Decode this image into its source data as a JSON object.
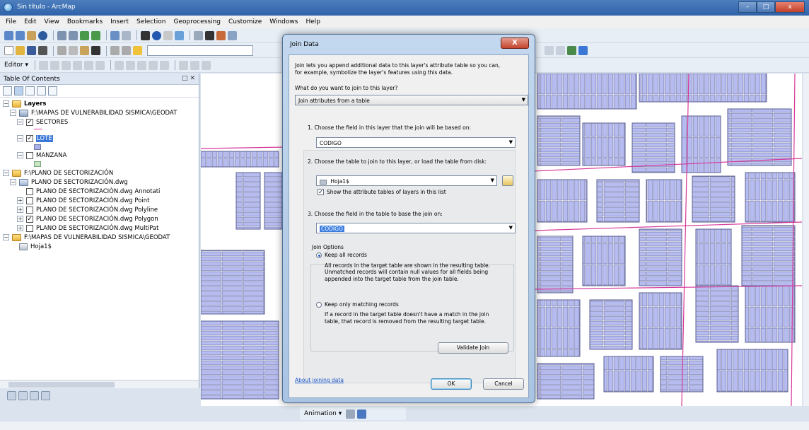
{
  "window": {
    "title": "Sin título - ArcMap"
  },
  "menu": [
    "File",
    "Edit",
    "View",
    "Bookmarks",
    "Insert",
    "Selection",
    "Geoprocessing",
    "Customize",
    "Windows",
    "Help"
  ],
  "toolbar": {
    "editor_label": "Editor ▾"
  },
  "toc": {
    "title": "Table Of Contents",
    "layers_label": "Layers",
    "items": [
      "F:\\MAPAS DE VULNERABILIDAD SISMICA\\GEODAT",
      "SECTORES",
      "LOTE",
      "MANZANA",
      "F:\\PLANO DE SECTORIZACIÓN",
      "PLANO DE SECTORIZACIÓN.dwg",
      "PLANO DE SECTORIZACIÓN.dwg Annotati",
      "PLANO DE SECTORIZACIÓN.dwg Point",
      "PLANO DE SECTORIZACIÓN.dwg Polyline",
      "PLANO DE SECTORIZACIÓN.dwg Polygon",
      "PLANO DE SECTORIZACIÓN.dwg MultiPat",
      "F:\\MAPAS DE VULNERABILIDAD SISMICA\\GEODAT",
      "Hoja1$"
    ]
  },
  "animation": {
    "label": "Animation ▾"
  },
  "dialog": {
    "title": "Join Data",
    "close": "X",
    "intro_line1": "Join lets you append additional data to this layer's attribute table so you can,",
    "intro_line2": "for example, symbolize the layer's features using this data.",
    "question": "What do you want to join to this layer?",
    "join_type": "Join attributes from a table",
    "step1": "1.  Choose the field in this layer that the join will be based on:",
    "field1": "CODIGO",
    "step2": "2.  Choose the table to join to this layer, or load the table from disk:",
    "table": "Hoja1$",
    "show_attr": "Show the attribute tables of layers in this list",
    "step3": "3.  Choose the field in the table to base the join on:",
    "field3": "CODIGO",
    "options_title": "Join Options",
    "keep_all": "Keep all records",
    "keep_all_d1": "All records in the target table are shown in the resulting table.",
    "keep_all_d2": "Unmatched records will contain null values for all fields being",
    "keep_all_d3": "appended into the target table from the join table.",
    "keep_match": "Keep only matching records",
    "keep_match_d1": "If a record in the target table doesn't have a match in the join",
    "keep_match_d2": "table, that record is removed from the resulting target table.",
    "validate": "Validate Join",
    "about": "About joining data",
    "ok": "OK",
    "cancel": "Cancel"
  }
}
